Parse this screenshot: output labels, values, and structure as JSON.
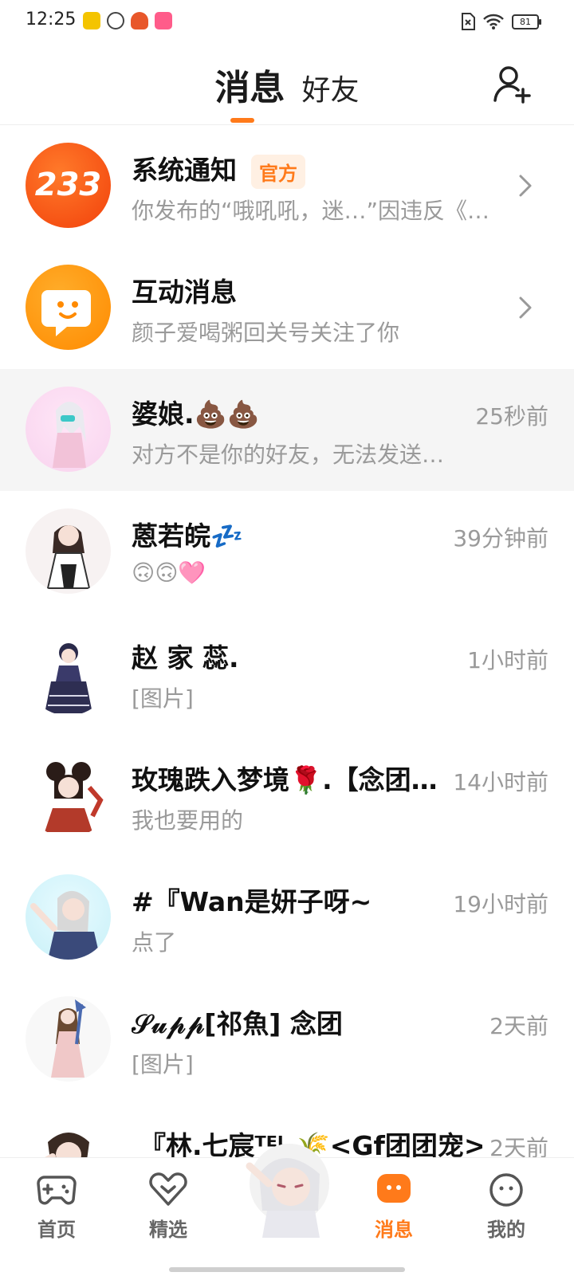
{
  "status_bar": {
    "time": "12:25",
    "battery": "81"
  },
  "header": {
    "tab_messages": "消息",
    "tab_friends": "好友"
  },
  "messages": [
    {
      "title": "系统通知",
      "badge": "官方",
      "preview": "你发布的“哦吼吼，迷…”因违反《…",
      "time": "",
      "avatar_text": "233"
    },
    {
      "title": "互动消息",
      "preview": "颜子爱喝粥回关号关注了你",
      "time": ""
    },
    {
      "title": "婆娘.💩💩",
      "preview": "对方不是你的好友，无法发送…",
      "time": "25秒前"
    },
    {
      "title": "蒽若皖💤",
      "preview": "🙃🙃🩷",
      "time": "39分钟前"
    },
    {
      "title": "赵 家 蕊.",
      "preview": "[图片]",
      "time": "1小时前"
    },
    {
      "title": "玫瑰跌入梦境🌹.【念团…",
      "preview": "我也要用的",
      "time": "14小时前"
    },
    {
      "title": "#『Wan是妍子呀~",
      "preview": "点了",
      "time": "19小时前"
    },
    {
      "title": "𝒮𝓊𝓅𝓅[祁魚] 念团",
      "preview": "[图片]",
      "time": "2天前"
    },
    {
      "title": "『林.七宸ᵀᴱᴸ     🌾<Gf团团宠>",
      "preview": "",
      "time": "2天前"
    }
  ],
  "bottom_nav": {
    "home": "首页",
    "featured": "精选",
    "messages": "消息",
    "mine": "我的"
  },
  "colors": {
    "accent": "#ff7a1a",
    "muted_text": "#9a9a9a"
  }
}
